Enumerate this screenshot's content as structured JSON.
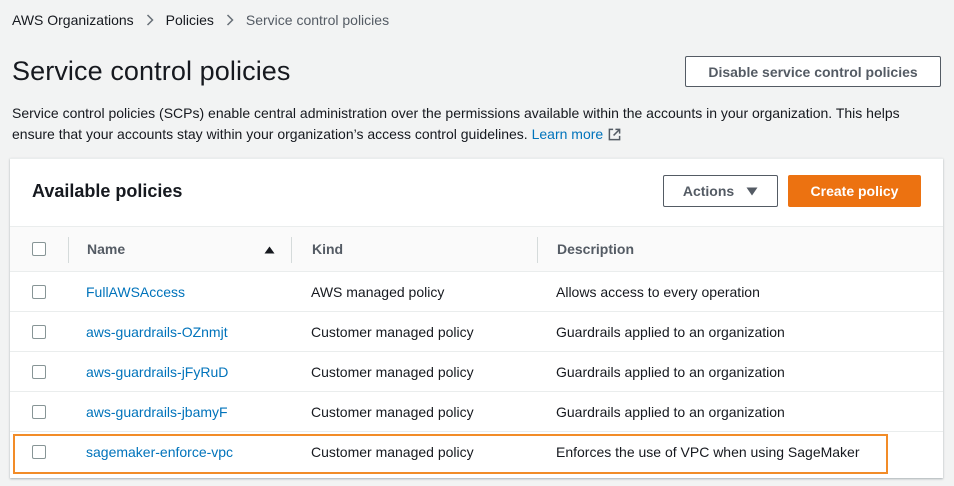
{
  "breadcrumb": {
    "items": [
      "AWS Organizations",
      "Policies",
      "Service control policies"
    ]
  },
  "page": {
    "title": "Service control policies",
    "disable_button": "Disable service control policies",
    "description": "Service control policies (SCPs) enable central administration over the permissions available within the accounts in your organization. This helps ensure that your accounts stay within your organization’s access control guidelines.",
    "learn_more": "Learn more"
  },
  "panel": {
    "title": "Available policies",
    "actions_label": "Actions",
    "create_label": "Create policy"
  },
  "table": {
    "columns": [
      "Name",
      "Kind",
      "Description"
    ],
    "sort_indicator": "ascending",
    "rows": [
      {
        "name": "FullAWSAccess",
        "kind": "AWS managed policy",
        "description": "Allows access to every operation"
      },
      {
        "name": "aws-guardrails-OZnmjt",
        "kind": "Customer managed policy",
        "description": "Guardrails applied to an organization"
      },
      {
        "name": "aws-guardrails-jFyRuD",
        "kind": "Customer managed policy",
        "description": "Guardrails applied to an organization"
      },
      {
        "name": "aws-guardrails-jbamyF",
        "kind": "Customer managed policy",
        "description": "Guardrails applied to an organization"
      },
      {
        "name": "sagemaker-enforce-vpc",
        "kind": "Customer managed policy",
        "description": "Enforces the use of VPC when using SageMaker"
      }
    ]
  },
  "colors": {
    "link": "#0073bb",
    "primary_button": "#ec7211",
    "highlight_border": "#f28c28"
  }
}
